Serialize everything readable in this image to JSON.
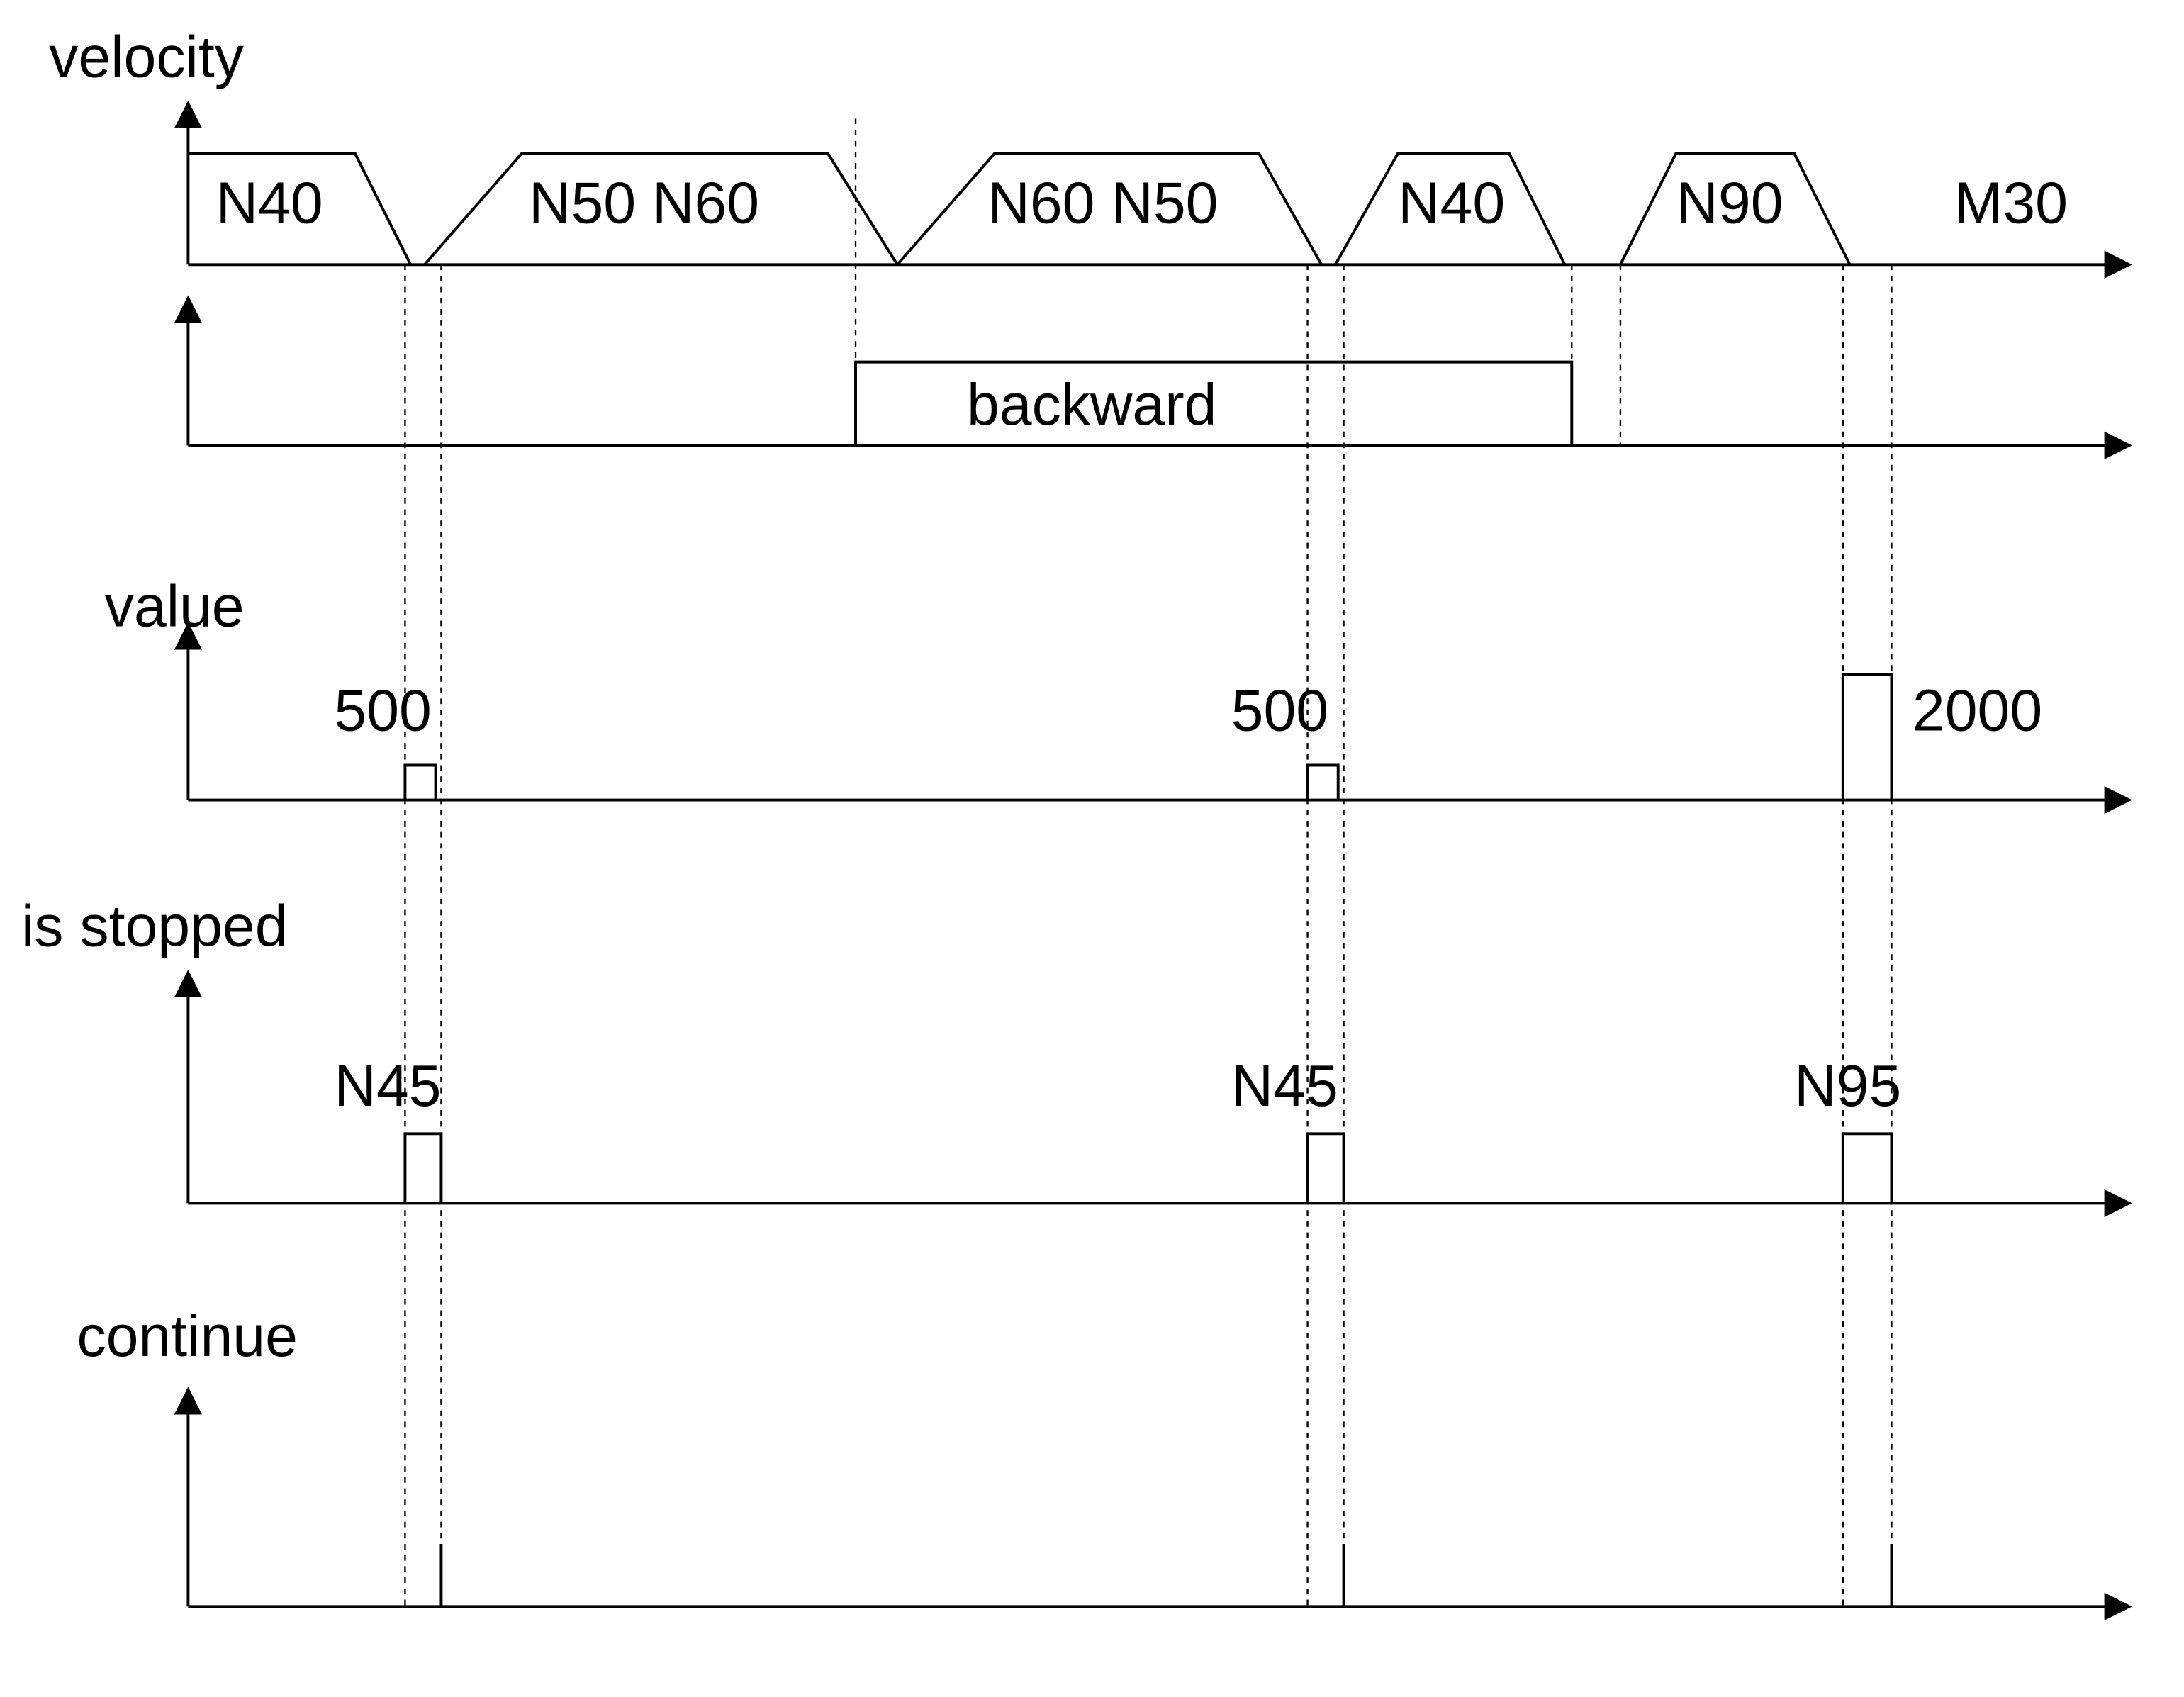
{
  "titles": {
    "velocity": "velocity",
    "value": "value",
    "is_stopped": "is stopped",
    "continue": "continue"
  },
  "velocity_row": {
    "blocks": [
      "N40",
      "N50  N60",
      "N60 N50",
      "N40",
      "N90",
      "M30"
    ]
  },
  "backward_label": "backward",
  "value_row": {
    "pulses": [
      {
        "label": "500"
      },
      {
        "label": "500"
      },
      {
        "label": "2000"
      }
    ]
  },
  "is_stopped_row": {
    "pulses": [
      {
        "label": "N45"
      },
      {
        "label": "N45"
      },
      {
        "label": "N95"
      }
    ]
  },
  "chart_data": {
    "type": "area",
    "title": "Timing diagram",
    "series": [
      {
        "name": "velocity",
        "segments": [
          "N40",
          "N50 N60",
          "N60 N50",
          "N40",
          "N90",
          "M30"
        ]
      },
      {
        "name": "backward",
        "high_during": [
          "N60→N40 reverse segment"
        ]
      },
      {
        "name": "value",
        "events": [
          {
            "at": "after N40 fwd",
            "value": 500
          },
          {
            "at": "after N50 rev",
            "value": 500
          },
          {
            "at": "after N90",
            "value": 2000
          }
        ]
      },
      {
        "name": "is_stopped",
        "events": [
          "N45",
          "N45",
          "N95"
        ]
      },
      {
        "name": "continue",
        "events": [
          "tick",
          "tick",
          "tick"
        ]
      }
    ]
  }
}
